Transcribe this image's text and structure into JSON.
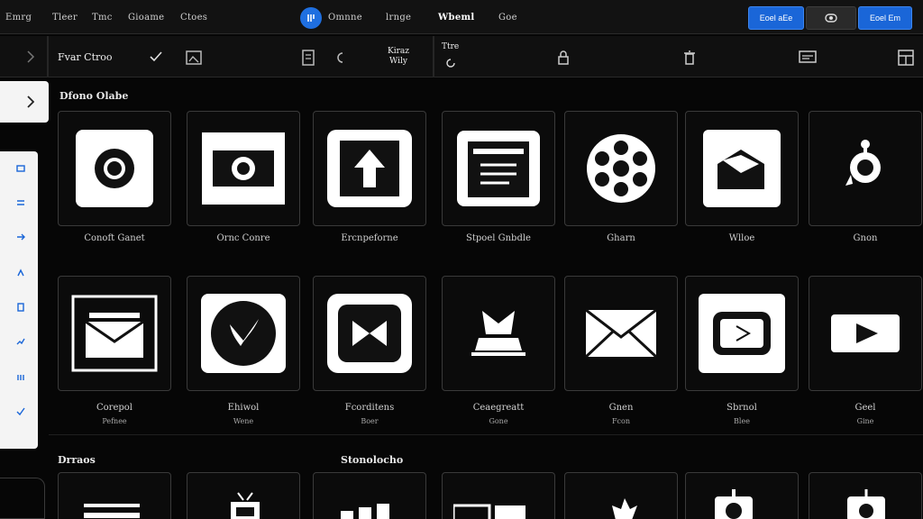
{
  "menubar": {
    "items": [
      "Emrg",
      "Tleer",
      "Tmc",
      "Gioame",
      "Ctoes"
    ],
    "center_items": [
      "Omnne",
      "lrnge",
      "Wbeml",
      "Goe"
    ],
    "buttons": [
      "Eoel aEe",
      "Eoel Em"
    ],
    "accent": "#1a66d8"
  },
  "toolbar": {
    "title": "Fvar Ctroo",
    "center_label_1": "Kiraz",
    "center_label_2": "Wily",
    "right_label": "Ttre"
  },
  "sections": [
    {
      "title": "Dfono Olabe"
    },
    {
      "title": "Drraos"
    },
    {
      "title": "Stonolocho"
    }
  ],
  "row1": [
    {
      "label": "Conoft Ganet",
      "icon": "record-icon"
    },
    {
      "label": "Ornc Conre",
      "icon": "camera-icon"
    },
    {
      "label": "Ercnpeforne",
      "icon": "upload-icon"
    },
    {
      "label": "Stpoel Gnbdle",
      "icon": "document-icon"
    },
    {
      "label": "Gharn",
      "icon": "film-reel-icon"
    },
    {
      "label": "Wlloe",
      "icon": "mailbox-icon"
    },
    {
      "label": "Gnon",
      "icon": "location-pin-icon"
    }
  ],
  "row2": [
    {
      "label": "Corepol",
      "sub": "Pefnee",
      "icon": "inbox-icon"
    },
    {
      "label": "Ehiwol",
      "sub": "Wene",
      "icon": "chat-icon"
    },
    {
      "label": "Fcorditens",
      "sub": "Boer",
      "icon": "bowtie-icon"
    },
    {
      "label": "Ceaegreatt",
      "sub": "Gone",
      "icon": "printer-icon"
    },
    {
      "label": "Gnen",
      "sub": "Fcon",
      "icon": "envelope-icon"
    },
    {
      "label": "Sbrnol",
      "sub": "Blee",
      "icon": "play-icon"
    },
    {
      "label": "Geel",
      "sub": "Gine",
      "icon": "video-icon"
    }
  ]
}
